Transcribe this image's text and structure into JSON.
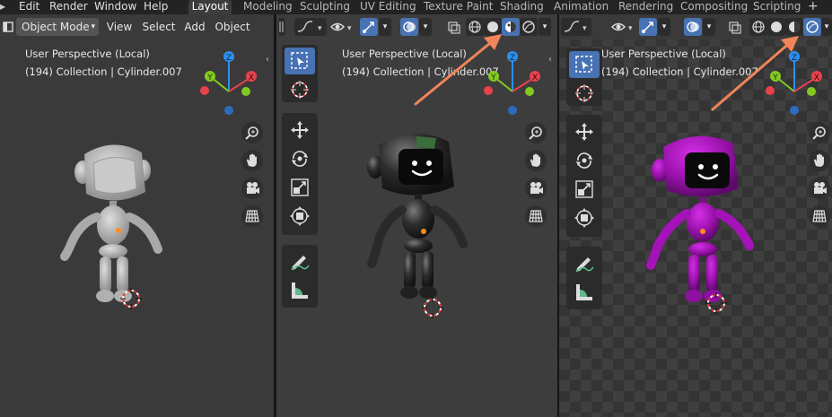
{
  "menu": [
    "Edit",
    "Render",
    "Window",
    "Help"
  ],
  "workspace_tabs": [
    "Layout",
    "Modeling",
    "Sculpting",
    "UV Editing",
    "Texture Paint",
    "Shading",
    "Animation",
    "Rendering",
    "Compositing",
    "Scripting"
  ],
  "workspace_tabs_active": "Layout",
  "viewport1": {
    "mode_label": "Object Mode",
    "header_menus": [
      "View",
      "Select",
      "Add",
      "Object"
    ]
  },
  "overlay": {
    "perspective": "User Perspective (Local)",
    "collection": "(194) Collection | Cylinder.007"
  },
  "shading_modes": {
    "viewport1": "solid",
    "viewport2": "material-preview",
    "viewport3": "rendered"
  },
  "gizmo_axes": [
    "Z",
    "Y",
    "X"
  ],
  "colors": {
    "accent_blue": "#4772b3",
    "annotation_arrow": "#f0845a",
    "axis_x": "#e8424d",
    "axis_y": "#83c920",
    "axis_z": "#2e8ff0",
    "robot_solid": "#bdbdbd",
    "robot_material": "#2a2a2a",
    "robot_rendered": "#b015c2"
  },
  "icons": {
    "navigation": [
      "zoom-icon",
      "hand-pan-icon",
      "camera-icon",
      "grid-ortho-icon"
    ],
    "tools": [
      "select-box-icon",
      "cursor-icon",
      "move-icon",
      "rotate-icon",
      "scale-icon",
      "transform-icon",
      "annotate-icon",
      "measure-icon"
    ]
  }
}
